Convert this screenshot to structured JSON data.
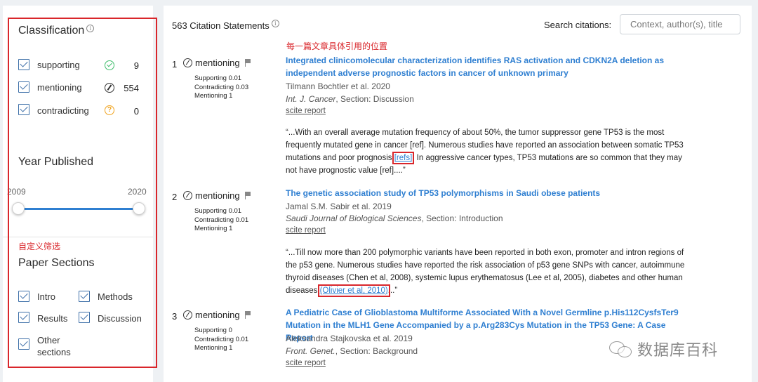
{
  "sidebar": {
    "classification_title": "Classification",
    "classification": [
      {
        "label": "supporting",
        "count": "9"
      },
      {
        "label": "mentioning",
        "count": "554"
      },
      {
        "label": "contradicting",
        "count": "0"
      }
    ],
    "year_title": "Year Published",
    "year_min": "2009",
    "year_max": "2020",
    "custom_filter_note": "自定义筛选",
    "sections_title": "Paper Sections",
    "sections": [
      "Intro",
      "Methods",
      "Results",
      "Discussion",
      "Other sections"
    ]
  },
  "header": {
    "count_label": "563 Citation Statements",
    "search_label": "Search citations:",
    "search_placeholder": "Context, author(s), title"
  },
  "annotation": "每一篇文章具体引用的位置",
  "citations": [
    {
      "num": "1",
      "type": "mentioning",
      "supporting": "Supporting 0.01",
      "contradicting": "Contradicting 0.03",
      "mentioning": "Mentioning 1",
      "title": "Integrated clinicomolecular characterization identifies RAS activation and CDKN2A deletion as independent adverse prognostic factors in cancer of unknown primary",
      "authors": "Tilmann Bochtler et al. 2020",
      "journal": "Int. J. Cancer",
      "section": ", Section: Discussion",
      "report": "scite report",
      "quote_before": "“...With an overall average mutation frequency of about 50%, the tumor suppressor gene TP53 is the most frequently mutated gene in cancer [ref]. Numerous studies have reported an association between somatic TP53 mutations and poor prognosis ",
      "quote_ref": "[refs]",
      "quote_after": ". In aggressive cancer types, TP53 mutations are so common that they may not have prognostic value [ref]....”"
    },
    {
      "num": "2",
      "type": "mentioning",
      "supporting": "Supporting 0.01",
      "contradicting": "Contradicting 0.01",
      "mentioning": "Mentioning 1",
      "title": "The genetic association study of TP53 polymorphisms in Saudi obese patients",
      "authors": "Jamal S.M. Sabir et al. 2019",
      "journal": "Saudi Journal of Biological Sciences",
      "section": ", Section: Introduction",
      "report": "scite report",
      "quote_before": "“...Till now more than 200 polymorphic variants have been reported in both exon, promoter and intron regions of the p53 gene. Numerous studies have reported the risk association of p53 gene SNPs with cancer, autoimmune thyroid diseases (Chen et al, 2008), systemic lupus erythematosus (Lee et al, 2005), diabetes and other human diseases ",
      "quote_ref": "(Olivier et al, 2010)",
      "quote_after": "...”"
    },
    {
      "num": "3",
      "type": "mentioning",
      "supporting": "Supporting 0",
      "contradicting": "Contradicting 0.01",
      "mentioning": "Mentioning 1",
      "title": "A Pediatric Case of Glioblastoma Multiforme Associated With a Novel Germline p.His112CysfsTer9 Mutation in the MLH1 Gene Accompanied by a p.Arg283Cys Mutation in the TP53 Gene: A Case Report",
      "authors": "Aleksandra Stajkovska et al. 2019",
      "journal": "Front. Genet.",
      "section": ", Section: Background",
      "report": "scite report"
    }
  ],
  "watermark": "数据库百科",
  "colors": {
    "accent": "#2f7fd1",
    "annotation_red": "#d9262b",
    "supporting_green": "#3dbd6a",
    "contradicting_orange": "#f0a21c"
  }
}
